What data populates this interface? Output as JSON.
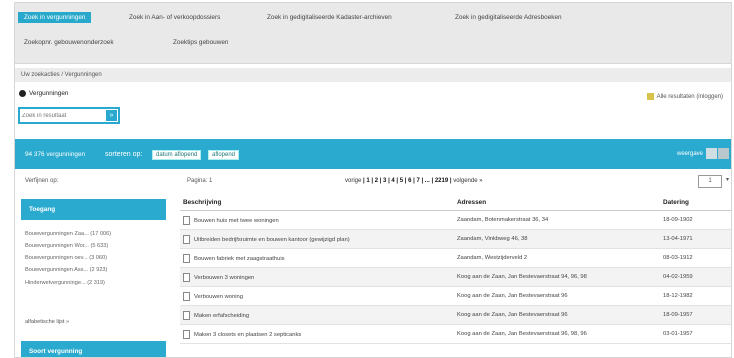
{
  "tabs": [
    "Zoek in vergunningen",
    "Zoek in Aan- of verkoopdossiers",
    "Zoek in gedigitaliseerde Kadaster-archieven",
    "Zoek in gedigitaliseerde Adresboeken",
    "Zoekopnr. gebouwenonderzoek",
    "Zoektips gebouwen"
  ],
  "breadcrumb": "Uw zoekacties / Vergunningen",
  "section_title": "Vergunningen",
  "search": {
    "placeholder": "Zoek in resultaat",
    "button": "»"
  },
  "export_link": "Alle resultaten (inloggen)",
  "results_bar": {
    "count": "94 376 vergunningen",
    "sort_label": "sorteren op:",
    "sort_options": [
      "datum aflopend",
      "aflopend"
    ],
    "view_label": "weergave"
  },
  "refine_label": "Verfijnen op:",
  "pagination": {
    "label": "Pagina: 1",
    "prev": "vorige",
    "pages": "| 1 | 2 | 3 | 4 | 5 | 6 | 7 | ... | 2219 |",
    "next": "volgende »",
    "page_value": "1"
  },
  "facets": {
    "type_title": "Toegang",
    "type_items": [
      "Bouwvergunningen Zaa... (17 006)",
      "Bouwvergunningen Wor... (5 633)",
      "Bouwvergunningen oev... (3 060)",
      "Bouwvergunningen Ass... (2 923)",
      "Hinderwetvergunninge... (2 319)"
    ],
    "more": "alfabetische lijst »",
    "second_title": "Soort vergunning"
  },
  "table": {
    "columns": [
      "Beschrijving",
      "Adressen",
      "Datering"
    ],
    "rows": [
      [
        "Bouwen huis met twee woningen",
        "Zaandam, Botenmakerstraat 36, 34",
        "18-09-1902"
      ],
      [
        "Uitbreiden bedrijfsruimte en bouwen kantoor (gewijzigd plan)",
        "Zaandam, Vinkbweg 46, 38",
        "13-04-1971"
      ],
      [
        "Bouwen fabriek met zaagstraathuis",
        "Zaandam, Westzijderveld 2",
        "08-03-1912"
      ],
      [
        "Verbouwen 3 woningen",
        "Koog aan de Zaan, Jan Bestevaerstraat 94, 96, 98",
        "04-02-1959"
      ],
      [
        "Verbouwen woning",
        "Koog aan de Zaan, Jan Bestevaerstraat 96",
        "18-12-1982"
      ],
      [
        "Maken erfafscheiding",
        "Koog aan de Zaan, Jan Bestevaerstraat 96",
        "18-09-1957"
      ],
      [
        "Maken 3 closets en plaatsen 2 septicanks",
        "Koog aan de Zaan, Jan Bestevaerstraat 96, 98, 96",
        "03-01-1957"
      ]
    ]
  }
}
